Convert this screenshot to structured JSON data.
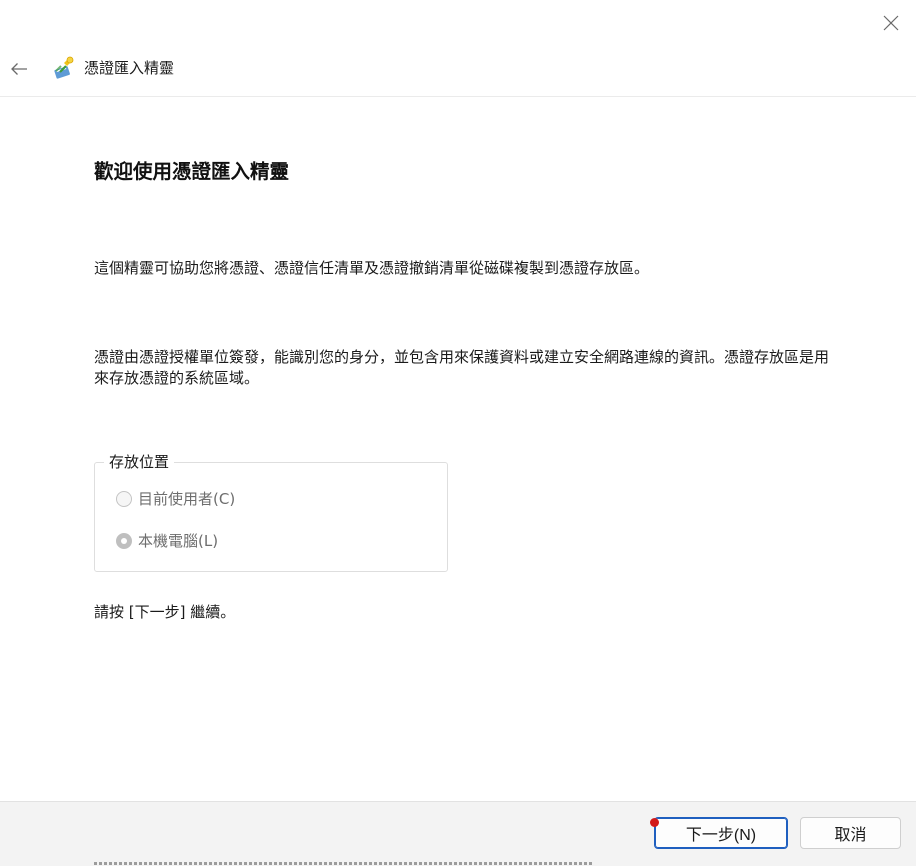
{
  "window": {
    "close_icon": "close-x-icon"
  },
  "header": {
    "back_icon": "back-arrow-icon",
    "app_icon": "certificate-wizard-icon",
    "title": "憑證匯入精靈"
  },
  "content": {
    "title": "歡迎使用憑證匯入精靈",
    "paragraph1": "這個精靈可協助您將憑證、憑證信任清單及憑證撤銷清單從磁碟複製到憑證存放區。",
    "paragraph2": "憑證由憑證授權單位簽發，能識別您的身分，並包含用來保護資料或建立安全網路連線的資訊。憑證存放區是用來存放憑證的系統區域。",
    "store_location": {
      "legend": "存放位置",
      "options": [
        {
          "label": "目前使用者(C)",
          "checked": false,
          "disabled": true
        },
        {
          "label": "本機電腦(L)",
          "checked": true,
          "disabled": true
        }
      ]
    },
    "paragraph3": "請按 [下一步] 繼續。"
  },
  "footer": {
    "next_label": "下一步(N)",
    "cancel_label": "取消"
  },
  "colors": {
    "accent_border": "#1f5fbf",
    "footer_bg": "#f3f3f3",
    "disabled_text": "#6e6e6e",
    "cursor_marker": "#d21a1a"
  }
}
